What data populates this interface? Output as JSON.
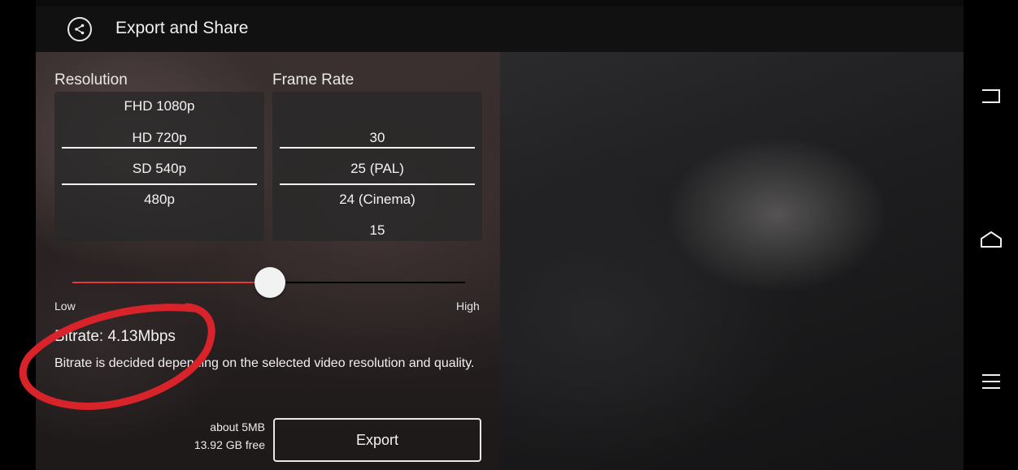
{
  "header": {
    "title": "Export and Share",
    "back_icon": "share-back-icon"
  },
  "resolution": {
    "label": "Resolution",
    "options": [
      "FHD 1080p",
      "HD 720p",
      "SD 540p",
      "480p"
    ],
    "selected": "SD 540p"
  },
  "frame_rate": {
    "label": "Frame Rate",
    "options": [
      "30",
      "25 (PAL)",
      "24 (Cinema)",
      "15"
    ],
    "selected": "25 (PAL)"
  },
  "quality_slider": {
    "low_label": "Low",
    "high_label": "High",
    "level": 0.5
  },
  "bitrate": {
    "value_text": "Bitrate: 4.13Mbps",
    "note": "Bitrate is decided depending on the selected video resolution and quality."
  },
  "export": {
    "size_estimate": "about 5MB",
    "free_space": "13.92 GB free",
    "button_label": "Export"
  },
  "navbar": {
    "back_icon": "nav-back-icon",
    "home_icon": "nav-home-icon",
    "menu_icon": "nav-menu-icon"
  },
  "colors": {
    "accent": "#e53935",
    "annotation": "#d8232a"
  }
}
